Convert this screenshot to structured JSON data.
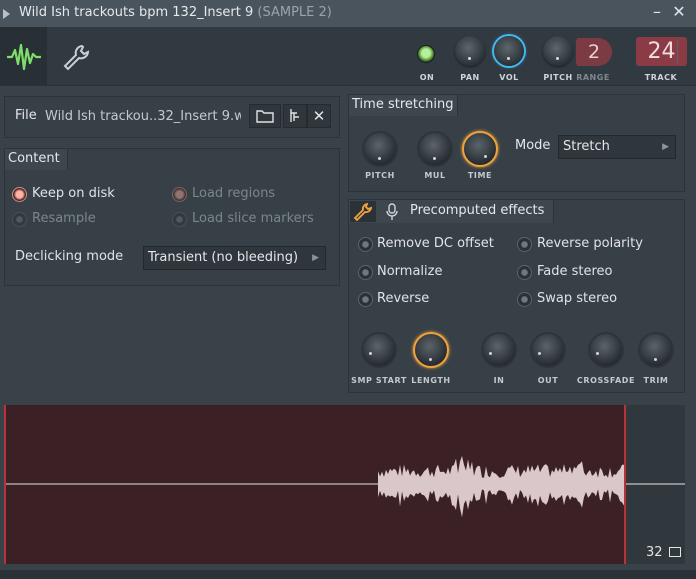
{
  "window": {
    "title": "Wild Ish trackouts bpm 132_Insert 9",
    "subtitle": "(SAMPLE 2)",
    "minimize_icon": "minimize-icon",
    "close_icon": "close-icon"
  },
  "toolbar": {
    "on_label": "ON",
    "pan_label": "PAN",
    "vol_label": "VOL",
    "pitch_label": "PITCH",
    "range_label": "RANGE",
    "range_value": "2",
    "track_label": "TRACK",
    "track_value": "24"
  },
  "file": {
    "label": "File",
    "name": "Wild Ish trackou..32_Insert 9.wav"
  },
  "content": {
    "heading": "Content",
    "options": {
      "keep_on_disk": "Keep on disk",
      "resample": "Resample",
      "load_regions": "Load regions",
      "load_slice_markers": "Load slice markers"
    },
    "declicking_label": "Declicking mode",
    "declicking_value": "Transient (no bleeding)"
  },
  "time_stretching": {
    "heading": "Time stretching",
    "knobs": {
      "pitch": "PITCH",
      "mul": "MUL",
      "time": "TIME"
    },
    "mode_label": "Mode",
    "mode_value": "Stretch"
  },
  "precomputed": {
    "heading": "Precomputed effects",
    "effects": {
      "remove_dc": "Remove DC offset",
      "normalize": "Normalize",
      "reverse": "Reverse",
      "reverse_polarity": "Reverse polarity",
      "fade_stereo": "Fade stereo",
      "swap_stereo": "Swap stereo"
    },
    "knobs": {
      "smp_start": "SMP START",
      "length": "LENGTH",
      "in": "IN",
      "out": "OUT",
      "crossfade": "CROSSFADE",
      "trim": "TRIM"
    }
  },
  "waveform": {
    "zoom_value": "32"
  },
  "colors": {
    "accent_blue": "#41b8f2",
    "accent_orange": "#f2a33b",
    "accent_green": "#7ee06a",
    "wave_bg": "#3b2025",
    "marker_red": "#b7333a"
  }
}
